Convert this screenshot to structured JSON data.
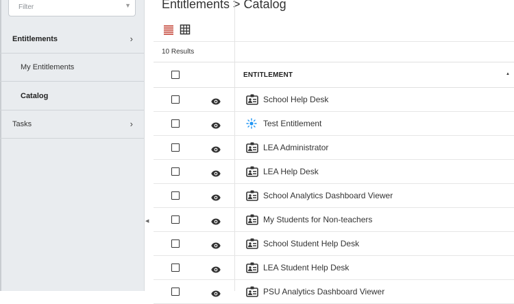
{
  "sidebar": {
    "filter_placeholder": "Filter",
    "items": [
      {
        "label": "Entitlements",
        "bold": true,
        "chevron": true,
        "sub": false
      },
      {
        "label": "My Entitlements",
        "bold": false,
        "chevron": false,
        "sub": true
      },
      {
        "label": "Catalog",
        "bold": true,
        "chevron": false,
        "sub": true
      },
      {
        "label": "Tasks",
        "bold": false,
        "chevron": true,
        "sub": false
      }
    ]
  },
  "main": {
    "title": "Entitlements > Catalog",
    "results_count": "10 Results",
    "column_header": "ENTITLEMENT",
    "rows": [
      {
        "name": "School Help Desk",
        "icon": "id-badge-icon"
      },
      {
        "name": "Test Entitlement",
        "icon": "starburst-icon"
      },
      {
        "name": "LEA Administrator",
        "icon": "id-badge-icon"
      },
      {
        "name": "LEA Help Desk",
        "icon": "id-badge-icon"
      },
      {
        "name": "School Analytics Dashboard Viewer",
        "icon": "id-badge-icon"
      },
      {
        "name": "My Students for Non-teachers",
        "icon": "id-badge-icon"
      },
      {
        "name": "School Student Help Desk",
        "icon": "id-badge-icon"
      },
      {
        "name": "LEA Student Help Desk",
        "icon": "id-badge-icon"
      },
      {
        "name": "PSU Analytics Dashboard Viewer",
        "icon": "id-badge-icon"
      }
    ]
  },
  "colors": {
    "sidebar_bg": "#e9ecef",
    "list_view_active": "#c0392b",
    "starburst_icon": "#2196f3",
    "text": "#333333"
  }
}
